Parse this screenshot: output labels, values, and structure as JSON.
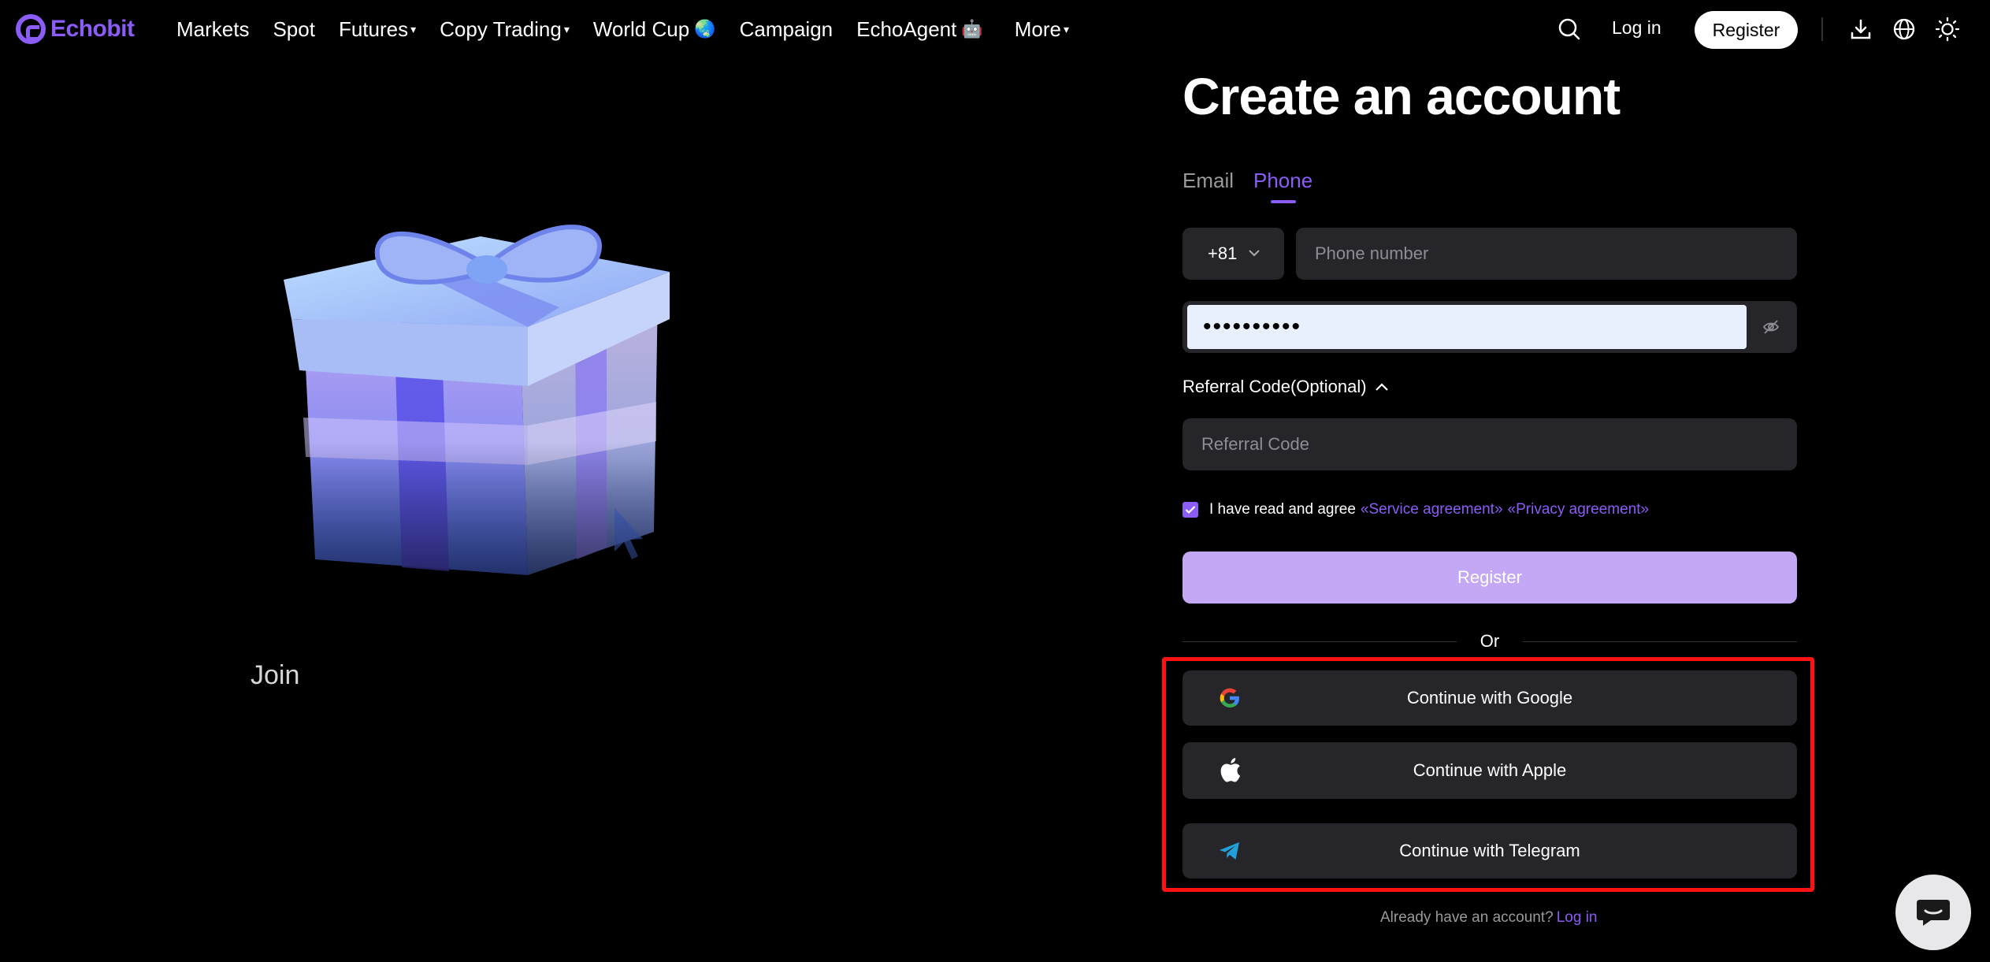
{
  "nav": {
    "logo_text": "Echobit",
    "items": [
      {
        "label": "Markets",
        "caret": ""
      },
      {
        "label": "Spot",
        "caret": ""
      },
      {
        "label": "Futures",
        "caret": "▾"
      },
      {
        "label": "Copy Trading",
        "caret": "▾"
      },
      {
        "label": "World Cup",
        "caret": "",
        "emoji": "🌏"
      },
      {
        "label": "Campaign",
        "caret": ""
      },
      {
        "label": "EchoAgent",
        "caret": "",
        "emoji": "🤖"
      },
      {
        "label": "More",
        "caret": "▾"
      }
    ],
    "login_label": "Log in",
    "register_label": "Register",
    "icons": [
      "search-icon",
      "download-icon",
      "globe-icon",
      "sun-icon"
    ]
  },
  "hero": {
    "join_text": "Join"
  },
  "form": {
    "title": "Create an account",
    "tabs": [
      {
        "label": "Email",
        "active": false
      },
      {
        "label": "Phone",
        "active": true
      }
    ],
    "country_code": "+81",
    "phone_placeholder": "Phone number",
    "password_value": "••••••••••",
    "referral_label": "Referral Code(Optional)",
    "referral_placeholder": "Referral Code",
    "agree_text": "I have read and agree",
    "service_link": "«Service agreement»",
    "privacy_link": "«Privacy agreement»",
    "agree_checked": true,
    "register_label": "Register",
    "or_text": "Or",
    "social": [
      {
        "label": "Continue with Google",
        "icon": "google-icon"
      },
      {
        "label": "Continue with Apple",
        "icon": "apple-icon"
      },
      {
        "label": "Continue with Telegram",
        "icon": "telegram-icon"
      }
    ],
    "footer_text": "Already have an account?",
    "footer_link": "Log in"
  },
  "colors": {
    "accent": "#8b5cf6",
    "background": "#000000",
    "field": "#26262a",
    "register_disabled": "#c4a8f5",
    "highlight_box": "#ff1212"
  }
}
